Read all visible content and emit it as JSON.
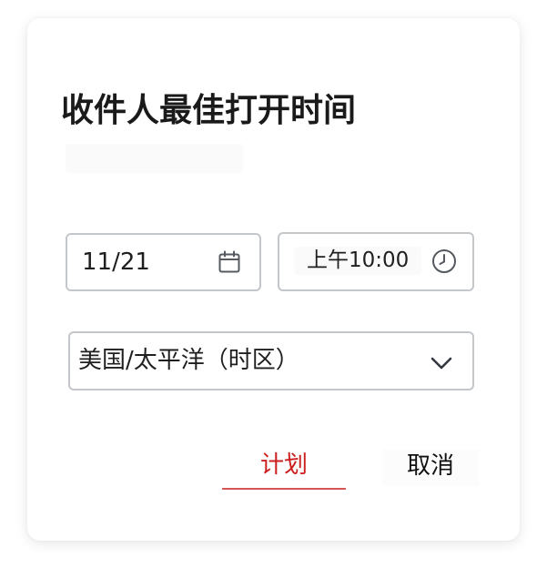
{
  "dialog": {
    "title": "收件人最佳打开时间"
  },
  "date_field": {
    "value": "11/21",
    "icon": "calendar-icon"
  },
  "time_field": {
    "value": "上午10:00",
    "icon": "clock-icon"
  },
  "timezone_select": {
    "selected": "美国/太平洋（时区）",
    "icon": "chevron-down-icon"
  },
  "actions": {
    "schedule_label": "计划",
    "cancel_label": "取消"
  },
  "colors": {
    "accent": "#cc1f1f",
    "border": "#c3c6ca",
    "text": "#1a1a1a"
  }
}
